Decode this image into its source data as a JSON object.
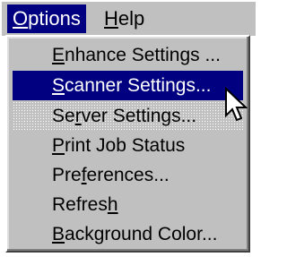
{
  "menubar": {
    "options": {
      "pre": "",
      "key": "O",
      "post": "ptions"
    },
    "help": {
      "pre": "",
      "key": "H",
      "post": "elp"
    }
  },
  "menu": {
    "items": [
      {
        "pre": "",
        "key": "E",
        "post": "nhance Settings ..."
      },
      {
        "pre": "",
        "key": "S",
        "post": "canner Settings..."
      },
      {
        "pre": "Se",
        "key": "r",
        "post": "ver Settings..."
      },
      {
        "pre": "",
        "key": "P",
        "post": "rint Job Status"
      },
      {
        "pre": "Pre",
        "key": "f",
        "post": "erences..."
      },
      {
        "pre": "Refres",
        "key": "h",
        "post": ""
      },
      {
        "pre": "",
        "key": "B",
        "post": "ackground Color..."
      }
    ]
  },
  "colors": {
    "menu_bg": "#c0c0c0",
    "highlight_bg": "#000080",
    "highlight_text": "#ffffff"
  },
  "icons": {
    "cursor": "arrow-cursor-icon"
  }
}
